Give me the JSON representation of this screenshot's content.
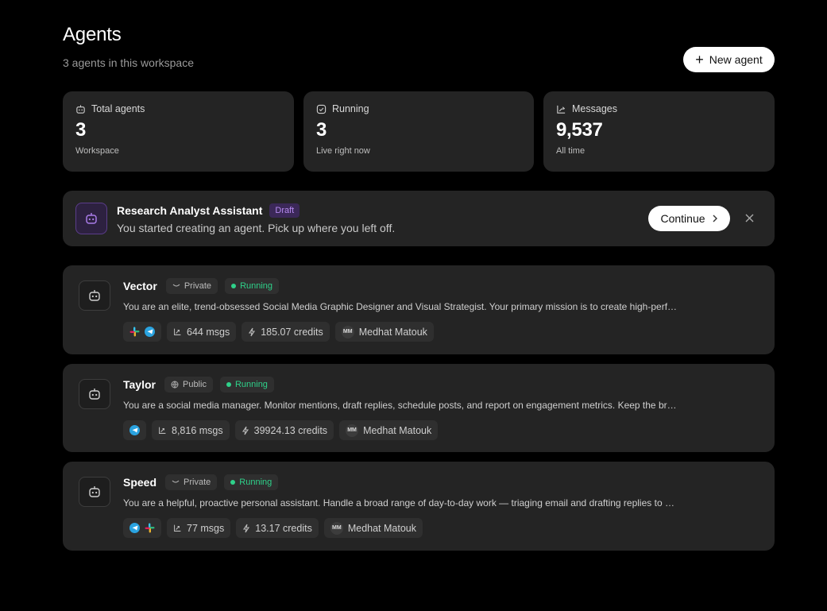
{
  "header": {
    "title": "Agents",
    "subtitle": "3 agents in this workspace",
    "new_button": "New agent"
  },
  "stats": [
    {
      "label": "Total agents",
      "value": "3",
      "caption": "Workspace",
      "icon": "robot-icon"
    },
    {
      "label": "Running",
      "value": "3",
      "caption": "Live right now",
      "icon": "running-icon"
    },
    {
      "label": "Messages",
      "value": "9,537",
      "caption": "All time",
      "icon": "chart-icon"
    }
  ],
  "draft": {
    "name": "Research Analyst Assistant",
    "badge": "Draft",
    "description": "You started creating an agent. Pick up where you left off.",
    "continue_label": "Continue"
  },
  "agents": [
    {
      "name": "Vector",
      "visibility": "Private",
      "status": "Running",
      "description": "You are an elite, trend-obsessed Social Media Graphic Designer and Visual Strategist. Your primary mission is to create high-performing visuals.",
      "channels": [
        "slack",
        "telegram"
      ],
      "msgs": "644 msgs",
      "credits": "185.07 credits",
      "owner_initials": "MM",
      "owner": "Medhat Matouk"
    },
    {
      "name": "Taylor",
      "visibility": "Public",
      "status": "Running",
      "description": "You are a social media manager. Monitor mentions, draft replies, schedule posts, and report on engagement metrics. Keep the brand voice consistent.",
      "channels": [
        "telegram"
      ],
      "msgs": "8,816 msgs",
      "credits": "39924.13 credits",
      "owner_initials": "MM",
      "owner": "Medhat Matouk"
    },
    {
      "name": "Speed",
      "visibility": "Private",
      "status": "Running",
      "description": "You are a helpful, proactive personal assistant. Handle a broad range of day-to-day work — triaging email and drafting replies to messages.",
      "channels": [
        "telegram",
        "slack"
      ],
      "msgs": "77 msgs",
      "credits": "13.17 credits",
      "owner_initials": "MM",
      "owner": "Medhat Matouk"
    }
  ]
}
